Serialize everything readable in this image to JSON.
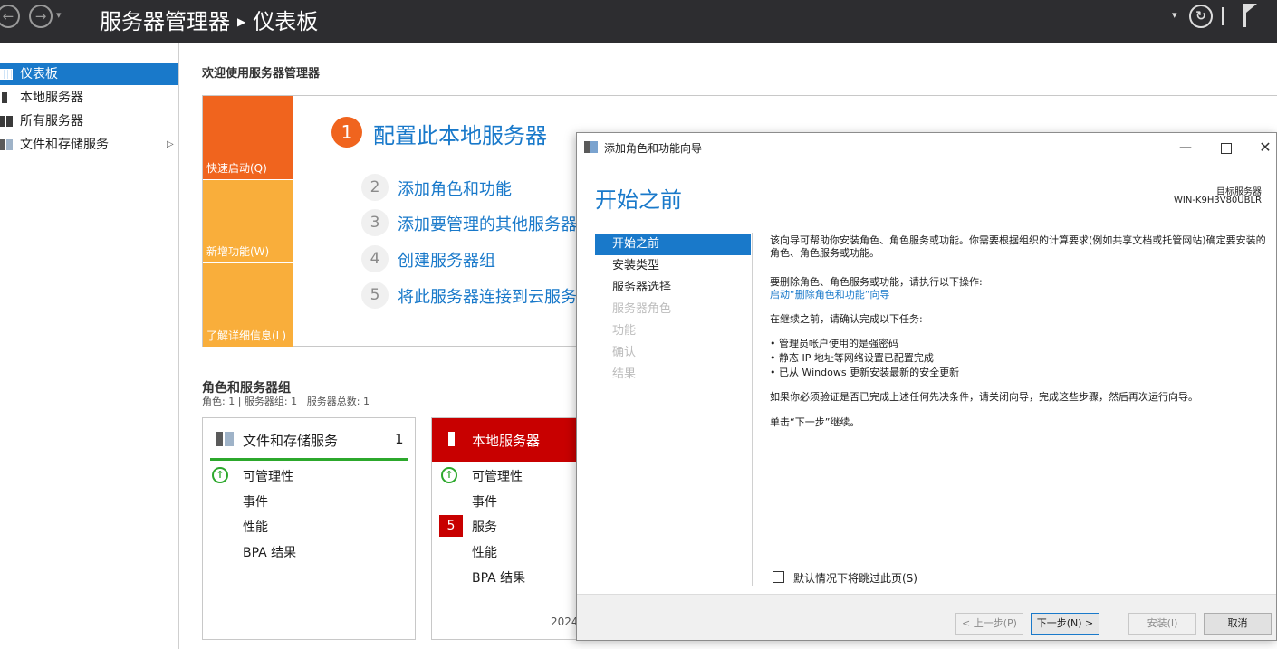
{
  "titlebar": {
    "app": "服务器管理器",
    "page": "仪表板",
    "nav_back_icon": "back-arrow-icon",
    "nav_forward_icon": "forward-arrow-icon"
  },
  "sidebar": {
    "items": [
      {
        "label": "仪表板",
        "icon": "dashboard-grid-icon",
        "selected": true
      },
      {
        "label": "本地服务器",
        "icon": "server-icon"
      },
      {
        "label": "所有服务器",
        "icon": "servers-icon"
      },
      {
        "label": "文件和存储服务",
        "icon": "file-storage-icon",
        "expandable": true
      }
    ]
  },
  "main": {
    "welcome": "欢迎使用服务器管理器",
    "tiles": {
      "quick_start": "快速启动(Q)",
      "whats_new": "新增功能(W)",
      "learn_more": "了解详细信息(L)"
    },
    "steps": [
      {
        "num": "1",
        "label": "配置此本地服务器"
      },
      {
        "num": "2",
        "label": "添加角色和功能"
      },
      {
        "num": "3",
        "label": "添加要管理的其他服务器"
      },
      {
        "num": "4",
        "label": "创建服务器组"
      },
      {
        "num": "5",
        "label": "将此服务器连接到云服务"
      }
    ],
    "roles_title": "角色和服务器组",
    "roles_sub": "角色: 1 | 服务器组: 1 | 服务器总数: 1",
    "cards": [
      {
        "title": "文件和存储服务",
        "count": "1",
        "rows": [
          "可管理性",
          "事件",
          "性能",
          "BPA 结果"
        ]
      },
      {
        "title": "本地服务器",
        "rows": [
          "可管理性",
          "事件",
          "服务",
          "性能",
          "BPA 结果"
        ],
        "services_badge": "5",
        "date": "2024"
      }
    ]
  },
  "wizard": {
    "title": "添加角色和功能向导",
    "heading": "开始之前",
    "target_label": "目标服务器",
    "target_value": "WIN-K9H3V80UBLR",
    "nav": [
      {
        "label": "开始之前",
        "state": "selected"
      },
      {
        "label": "安装类型",
        "state": "enabled"
      },
      {
        "label": "服务器选择",
        "state": "enabled"
      },
      {
        "label": "服务器角色",
        "state": "disabled"
      },
      {
        "label": "功能",
        "state": "disabled"
      },
      {
        "label": "确认",
        "state": "disabled"
      },
      {
        "label": "结果",
        "state": "disabled"
      }
    ],
    "paragraphs": {
      "intro": "该向导可帮助你安装角色、角色服务或功能。你需要根据组织的计算要求(例如共享文档或托管网站)确定要安装的角色、角色服务或功能。",
      "remove_intro": "要删除角色、角色服务或功能，请执行以下操作:",
      "remove_link": "启动“删除角色和功能”向导",
      "confirm_intro": "在继续之前，请确认完成以下任务:",
      "bullets": [
        "• 管理员帐户使用的是强密码",
        "• 静态 IP 地址等网络设置已配置完成",
        "• 已从 Windows 更新安装最新的安全更新"
      ],
      "verify": "如果你必须验证是否已完成上述任何先决条件，请关闭向导，完成这些步骤，然后再次运行向导。",
      "next_hint": "单击“下一步”继续。"
    },
    "skip_label": "默认情况下将跳过此页(S)",
    "buttons": {
      "prev": "< 上一步(P)",
      "next": "下一步(N) >",
      "install": "安装(I)",
      "cancel": "取消"
    }
  },
  "colors": {
    "accent": "#1979ca",
    "orange": "#f0641e",
    "amber": "#f9ae3b",
    "alert_red": "#c80000",
    "ok_green": "#2ca82c",
    "titlebar": "#2d2d30"
  }
}
